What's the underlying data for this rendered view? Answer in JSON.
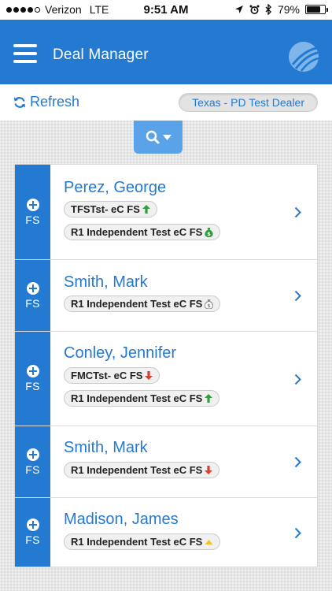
{
  "status_bar": {
    "carrier": "Verizon",
    "network": "LTE",
    "time": "9:51 AM",
    "battery": "79%",
    "battery_level": 0.79,
    "signal_bars_filled": 4,
    "signal_bars_total": 5,
    "icons": [
      "location-arrow-icon",
      "alarm-icon",
      "bluetooth-icon",
      "battery-icon"
    ]
  },
  "header": {
    "title": "Deal Manager",
    "menu_icon": "hamburger-menu-icon",
    "logo_icon": "app-logo-icon"
  },
  "toolbar": {
    "refresh_label": "Refresh",
    "refresh_icon": "refresh-icon",
    "dealer": "Texas - PD Test Dealer"
  },
  "search": {
    "icon": "search-icon",
    "toggle_icon": "caret-down-icon"
  },
  "colors": {
    "primary": "#2479d1",
    "search_tab": "#5ba3e8",
    "status_up": "#2ea043",
    "status_down": "#e53b2c",
    "status_neutral": "#f0c419",
    "status_money_green": "#2ea043",
    "status_money_gray": "#8a8a8a"
  },
  "deals": [
    {
      "name": "Perez, George",
      "side_label": "FS",
      "side_icon": "plus-circle-icon",
      "lenders": [
        {
          "label": "TFSTst- eC FS",
          "status_icon": "arrow-up-icon"
        },
        {
          "label": "R1 Independent Test eC FS",
          "status_icon": "money-bag-green-icon"
        }
      ]
    },
    {
      "name": "Smith, Mark",
      "side_label": "FS",
      "side_icon": "plus-circle-icon",
      "lenders": [
        {
          "label": "R1 Independent Test eC FS",
          "status_icon": "money-bag-gray-icon"
        }
      ]
    },
    {
      "name": "Conley, Jennifer",
      "side_label": "FS",
      "side_icon": "plus-circle-icon",
      "lenders": [
        {
          "label": "FMCTst- eC FS",
          "status_icon": "arrow-down-icon"
        },
        {
          "label": "R1 Independent Test eC FS",
          "status_icon": "arrow-up-icon"
        }
      ]
    },
    {
      "name": "Smith, Mark",
      "side_label": "FS",
      "side_icon": "plus-circle-icon",
      "lenders": [
        {
          "label": "R1 Independent Test eC FS",
          "status_icon": "arrow-down-icon"
        }
      ]
    },
    {
      "name": "Madison, James",
      "side_label": "FS",
      "side_icon": "plus-circle-icon",
      "lenders": [
        {
          "label": "R1 Independent Test eC FS",
          "status_icon": "caret-up-yellow-icon"
        }
      ]
    }
  ]
}
